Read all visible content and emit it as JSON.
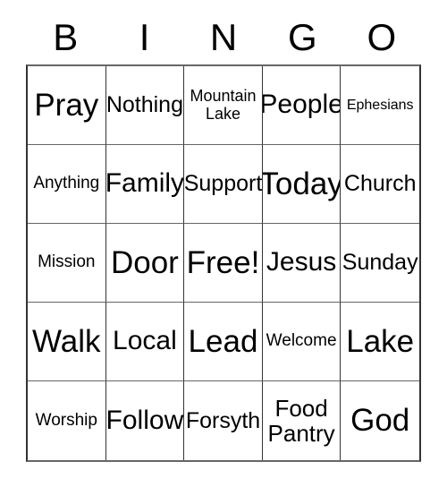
{
  "card": {
    "header_letters": [
      "B",
      "I",
      "N",
      "G",
      "O"
    ],
    "columns": [
      {
        "letter": "B",
        "cells": [
          {
            "text": "Pray",
            "size": "fs-xl"
          },
          {
            "text": "Anything",
            "size": "fs-sm"
          },
          {
            "text": "Mission",
            "size": "fs-sm"
          },
          {
            "text": "Walk",
            "size": "fs-xl"
          },
          {
            "text": "Worship",
            "size": "fs-sm"
          }
        ]
      },
      {
        "letter": "I",
        "cells": [
          {
            "text": "Nothing",
            "size": "fs-md"
          },
          {
            "text": "Family",
            "size": "fs-lg"
          },
          {
            "text": "Door",
            "size": "fs-xl"
          },
          {
            "text": "Local",
            "size": "fs-lg"
          },
          {
            "text": "Follow",
            "size": "fs-lg"
          }
        ]
      },
      {
        "letter": "N",
        "cells": [
          {
            "text": "Mountain\nLake",
            "size": "fs-two-sm"
          },
          {
            "text": "Support",
            "size": "fs-md"
          },
          {
            "text": "Free!",
            "size": "fs-xl"
          },
          {
            "text": "Lead",
            "size": "fs-xl"
          },
          {
            "text": "Forsyth",
            "size": "fs-md"
          }
        ]
      },
      {
        "letter": "G",
        "cells": [
          {
            "text": "People",
            "size": "fs-lg"
          },
          {
            "text": "Today",
            "size": "fs-xl"
          },
          {
            "text": "Jesus",
            "size": "fs-lg"
          },
          {
            "text": "Welcome",
            "size": "fs-sm"
          },
          {
            "text": "Food\nPantry",
            "size": "fs-two-md"
          }
        ]
      },
      {
        "letter": "O",
        "cells": [
          {
            "text": "Ephesians",
            "size": "fs-xs"
          },
          {
            "text": "Church",
            "size": "fs-md"
          },
          {
            "text": "Sunday",
            "size": "fs-md"
          },
          {
            "text": "Lake",
            "size": "fs-xl"
          },
          {
            "text": "God",
            "size": "fs-xl"
          }
        ]
      }
    ],
    "rows": [
      [
        "Pray",
        "Nothing",
        "Mountain\nLake",
        "People",
        "Ephesians"
      ],
      [
        "Anything",
        "Family",
        "Support",
        "Today",
        "Church"
      ],
      [
        "Mission",
        "Door",
        "Free!",
        "Jesus",
        "Sunday"
      ],
      [
        "Walk",
        "Local",
        "Lead",
        "Welcome",
        "Lake"
      ],
      [
        "Worship",
        "Follow",
        "Forsyth",
        "Food\nPantry",
        "God"
      ]
    ],
    "free_space": "Free!",
    "colors": {
      "background": "#ffffff",
      "text": "#000000",
      "grid_line": "#333333"
    }
  }
}
